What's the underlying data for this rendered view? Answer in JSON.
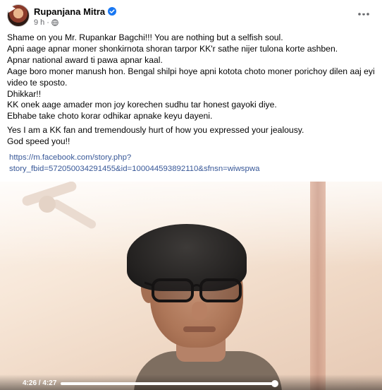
{
  "post": {
    "author": "Rupanjana Mitra",
    "time": "9 h",
    "meta_dot": "·",
    "icons": [
      "verified-badge-icon",
      "globe-icon",
      "more-options-icon"
    ],
    "lines": [
      "Shame on you Mr. Rupankar Bagchi!!! You are nothing but a selfish soul.",
      "Apni aage apnar moner shonkirnota shoran tarpor KK'r  sathe nijer tulona korte ashben.",
      "Apnar national award ti pawa apnar kaal.",
      "Aage boro moner manush hon. Bengal shilpi hoye apni kotota choto moner porichoy dilen aaj eyi",
      "video te sposto.",
      "Dhikkar!!",
      "KK onek aage amader mon joy korechen sudhu tar honest gayoki diye.",
      "Ebhabe take choto korar odhikar apnake keyu dayeni."
    ],
    "lines2": [
      "Yes I am a KK fan and tremendously hurt of how you expressed your jealousy.",
      "God speed you!!"
    ],
    "link_line1": "https://m.facebook.com/story.php?",
    "link_line2": "story_fbid=572050034291455&id=100044593892110&sfnsn=wiwspwa"
  },
  "video": {
    "current_time": "4:26",
    "separator": " / ",
    "duration": "4:27",
    "progress_fraction": 0.996,
    "icons": [
      "play-icon",
      "settings-icon",
      "volume-icon",
      "picture-in-picture-icon",
      "fullscreen-icon"
    ]
  },
  "colors": {
    "link": "#385898",
    "verified": "#1877f2",
    "secondary_text": "#65676b"
  }
}
